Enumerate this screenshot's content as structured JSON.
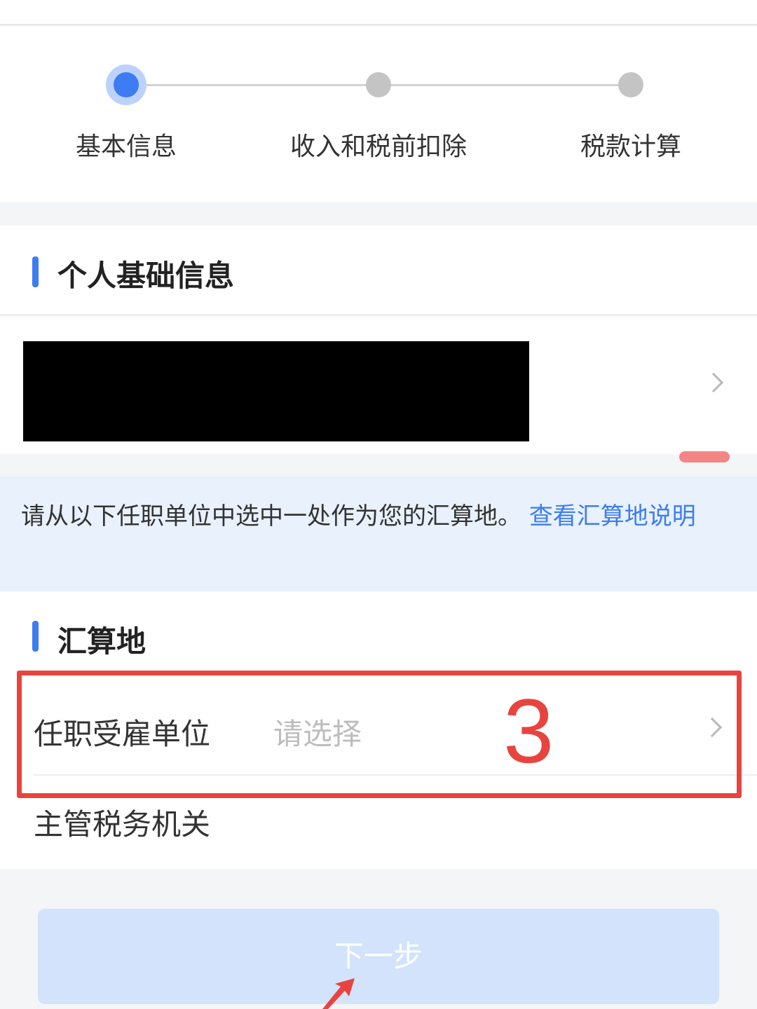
{
  "stepper": {
    "steps": [
      {
        "label": "基本信息",
        "state": "active"
      },
      {
        "label": "收入和税前扣除",
        "state": "inactive"
      },
      {
        "label": "税款计算",
        "state": "inactive"
      }
    ]
  },
  "personal_section": {
    "title": "个人基础信息"
  },
  "notice": {
    "text": "请从以下任职单位中选中一处作为您的汇算地。",
    "link_text": "查看汇算地说明"
  },
  "settlement_section": {
    "title": "汇算地",
    "employer_label": "任职受雇单位",
    "employer_placeholder": "请选择",
    "tax_authority_label": "主管税务机关"
  },
  "annotation": {
    "number": "3",
    "color": "#e8443f"
  },
  "next_button": {
    "label": "下一步"
  },
  "colors": {
    "accent": "#3d7cf2",
    "notice_bg": "#e8f1fc",
    "button_disabled": "#d2e3fb"
  }
}
